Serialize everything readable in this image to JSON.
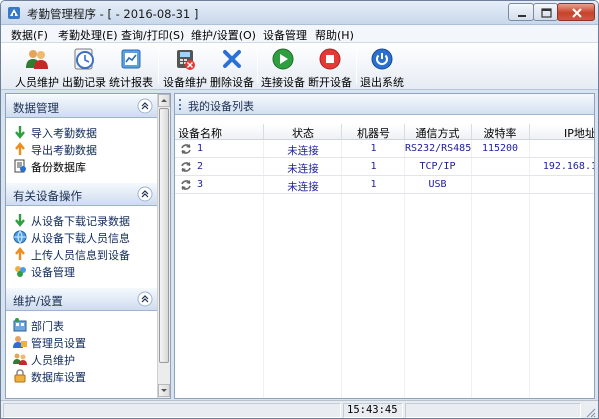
{
  "window": {
    "title": "考勤管理程序 - [ - 2016-08-31 ]"
  },
  "menu": [
    "数据(F)",
    "考勤处理(E)",
    "查询/打印(S)",
    "维护/设置(O)",
    "设备管理",
    "帮助(H)"
  ],
  "toolbar": {
    "buttons": [
      {
        "label": "人员维护",
        "icon": "people-icon"
      },
      {
        "label": "出勤记录",
        "icon": "clock-icon"
      },
      {
        "label": "统计报表",
        "icon": "report-icon"
      },
      {
        "label": "设备维护",
        "icon": "device-icon"
      },
      {
        "label": "删除设备",
        "icon": "delete-x-icon"
      },
      {
        "label": "连接设备",
        "icon": "play-icon"
      },
      {
        "label": "断开设备",
        "icon": "stop-icon"
      },
      {
        "label": "退出系统",
        "icon": "power-icon"
      }
    ]
  },
  "sidebar": {
    "sections": [
      {
        "title": "数据管理",
        "items": [
          {
            "label": "导入考勤数据",
            "icon": "arrow-down-green-icon"
          },
          {
            "label": "导出考勤数据",
            "icon": "arrow-up-orange-icon"
          },
          {
            "label": "备份数据库",
            "icon": "backup-document-icon"
          }
        ]
      },
      {
        "title": "有关设备操作",
        "items": [
          {
            "label": "从设备下载记录数据",
            "icon": "arrow-down-green-icon"
          },
          {
            "label": "从设备下载人员信息",
            "icon": "globe-icon"
          },
          {
            "label": "上传人员信息到设备",
            "icon": "arrow-up-orange-icon"
          },
          {
            "label": "设备管理",
            "icon": "device-group-icon"
          }
        ]
      },
      {
        "title": "维护/设置",
        "items": [
          {
            "label": "部门表",
            "icon": "department-icon"
          },
          {
            "label": "管理员设置",
            "icon": "admin-icon"
          },
          {
            "label": "人员维护",
            "icon": "people-icon"
          },
          {
            "label": "数据库设置",
            "icon": "lock-icon"
          }
        ]
      }
    ]
  },
  "device_list": {
    "title": "我的设备列表",
    "columns": [
      "设备名称",
      "状态",
      "机器号",
      "通信方式",
      "波特率",
      "IP地址"
    ],
    "rows": [
      {
        "name": "1",
        "status": "未连接",
        "machine": "1",
        "comm": "RS232/RS485",
        "baud": "115200",
        "ip": ""
      },
      {
        "name": "2",
        "status": "未连接",
        "machine": "1",
        "comm": "TCP/IP",
        "baud": "",
        "ip": "192.168.1"
      },
      {
        "name": "3",
        "status": "未连接",
        "machine": "1",
        "comm": "USB",
        "baud": "",
        "ip": ""
      }
    ]
  },
  "statusbar": {
    "time": "15:43:45"
  },
  "colors": {
    "accent": "#1b2f53",
    "link_text": "#2020a0",
    "panel_header": "#cfdcef"
  }
}
